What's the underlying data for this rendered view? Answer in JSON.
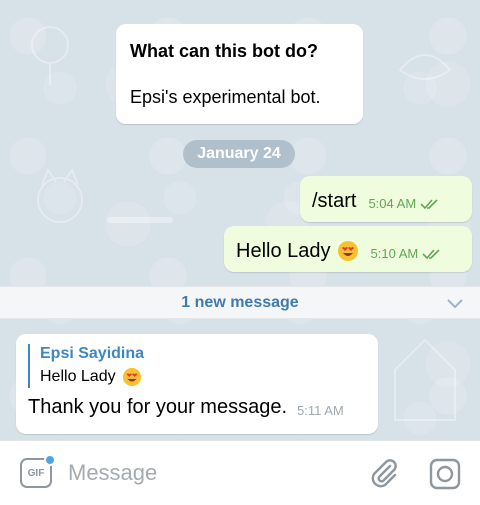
{
  "bot_info": {
    "title": "What can this bot do?",
    "description": "Epsi's experimental bot."
  },
  "date_separator": "January 24",
  "outgoing_messages": [
    {
      "text": "/start",
      "time": "5:04 AM",
      "status": "read"
    },
    {
      "text": "Hello Lady",
      "emoji": "heart-eyes",
      "time": "5:10 AM",
      "status": "read"
    }
  ],
  "new_messages_bar": {
    "label": "1 new message"
  },
  "incoming_message": {
    "reply_author": "Epsi Sayidina",
    "reply_text": "Hello Lady",
    "reply_emoji": "heart-eyes",
    "text": "Thank you for your message.",
    "time": "5:11 AM"
  },
  "composer": {
    "gif_label": "GIF",
    "placeholder": "Message",
    "icons": [
      "gif-icon",
      "attach-icon",
      "camera-icon"
    ]
  },
  "colors": {
    "outgoing_bubble": "#effdde",
    "check_marks": "#5fa84f",
    "accent_blue": "#3f87c4",
    "chat_background": "#d7e1e8"
  }
}
